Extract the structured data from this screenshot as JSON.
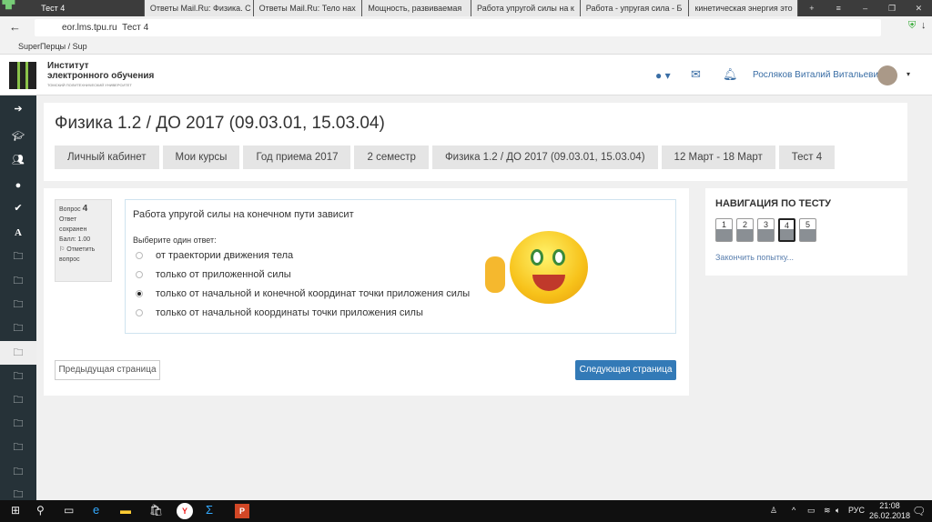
{
  "browser": {
    "tabs": [
      "Тест 4",
      "Ответы Mail.Ru: Физика. С",
      "Ответы Mail.Ru: Тело нах",
      "Мощность, развиваемая",
      "Работа упругой силы на к",
      "Работа - упругая сила - Б",
      "кинетическая энергия это"
    ],
    "url": "eor.lms.tpu.ru",
    "page_title": "Тест 4",
    "bookmark": "SuperПерцы / Sup"
  },
  "header": {
    "logo_line1": "Институт",
    "logo_line2": "электронного обучения",
    "logo_sub": "ТОМСКИЙ ПОЛИТЕХНИЧЕСКИЙ УНИВЕРСИТЕТ",
    "user": "Росляков Виталий Витальевич"
  },
  "course": {
    "title": "Физика 1.2 / ДО 2017 (09.03.01, 15.03.04)",
    "breadcrumbs": [
      "Личный кабинет",
      "Мои курсы",
      "Год приема 2017",
      "2 семестр",
      "Физика 1.2 / ДО 2017 (09.03.01, 15.03.04)",
      "12 Март - 18 Март",
      "Тест 4"
    ]
  },
  "question": {
    "label": "Вопрос",
    "number": "4",
    "state": "Ответ сохранен",
    "score": "Балл: 1.00",
    "flag": "Отметить вопрос",
    "text": "Работа упругой силы на конечном пути зависит",
    "prompt": "Выберите один ответ:",
    "options": [
      "от траектории движения тела",
      "только от приложенной силы",
      "только от начальной и конечной координат точки приложения силы",
      "только от начальной координаты точки приложения силы"
    ],
    "selected": 2
  },
  "buttons": {
    "prev": "Предыдущая страница",
    "next": "Следующая страница"
  },
  "nav": {
    "title": "НАВИГАЦИЯ ПО ТЕСТУ",
    "pages": [
      "1",
      "2",
      "3",
      "4",
      "5"
    ],
    "current": "4",
    "finish": "Закончить попытку..."
  },
  "taskbar": {
    "lang": "РУС",
    "time": "21:08",
    "date": "26.02.2018"
  },
  "colors": {
    "primary": "#337ab7",
    "sidebar": "#263238"
  }
}
